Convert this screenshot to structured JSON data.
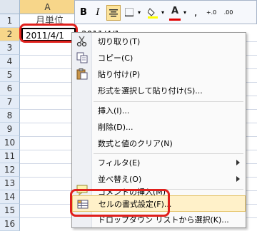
{
  "sheet": {
    "columns": [
      "A",
      ""
    ],
    "rows": [
      "1",
      "2",
      "3",
      "4",
      "5",
      "6",
      "7",
      "8",
      "9",
      "10",
      "11",
      "12",
      "13",
      "14",
      "15",
      "16"
    ],
    "cell_a1": "月単位",
    "cell_a2": "2011/4/1",
    "cell_b2": "2011/4/1"
  },
  "minitoolbar": {
    "bold": "B",
    "italic": "I",
    "font_color": "A",
    "comma": "‚",
    "inc_decimal": "+.0",
    "dec_decimal": ".00"
  },
  "context_menu": {
    "items": [
      {
        "label": "切り取り(T)",
        "icon": "scissors-icon"
      },
      {
        "label": "コピー(C)",
        "icon": "copy-icon"
      },
      {
        "label": "貼り付け(P)",
        "icon": "paste-icon"
      },
      {
        "label": "形式を選択して貼り付け(S)...",
        "icon": ""
      },
      {
        "label": "挿入(I)...",
        "icon": ""
      },
      {
        "label": "削除(D)...",
        "icon": ""
      },
      {
        "label": "数式と値のクリア(N)",
        "icon": ""
      },
      {
        "label": "フィルタ(E)",
        "icon": ""
      },
      {
        "label": "並べ替え(O)",
        "icon": ""
      },
      {
        "label": "コメントの挿入(M)",
        "icon": "comment-icon"
      },
      {
        "label": "セルの書式設定(F)...",
        "icon": "format-cells-icon"
      },
      {
        "label": "ドロップダウン リストから選択(K)...",
        "icon": ""
      }
    ]
  },
  "colors": {
    "highlight": "#e0201c",
    "selected_header": "#f7d68a"
  }
}
